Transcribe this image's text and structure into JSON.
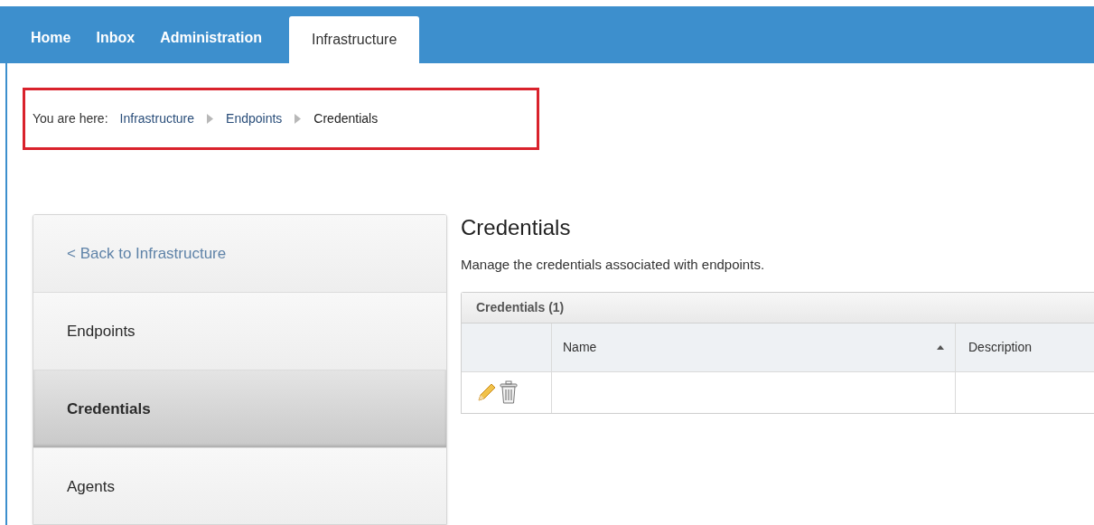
{
  "tabs": [
    {
      "label": "Home",
      "selected": false
    },
    {
      "label": "Inbox",
      "selected": false
    },
    {
      "label": "Administration",
      "selected": false
    },
    {
      "label": "Infrastructure",
      "selected": true
    }
  ],
  "breadcrumb": {
    "label": "You are here:",
    "items": [
      {
        "label": "Infrastructure",
        "kind": "link"
      },
      {
        "label": "Endpoints",
        "kind": "link"
      },
      {
        "label": "Credentials",
        "kind": "current"
      }
    ]
  },
  "sidebar": {
    "items": [
      {
        "label": "< Back to Infrastructure",
        "kind": "link",
        "selected": false
      },
      {
        "label": "Endpoints",
        "kind": "item",
        "selected": false
      },
      {
        "label": "Credentials",
        "kind": "item",
        "selected": true
      },
      {
        "label": "Agents",
        "kind": "item",
        "selected": false
      }
    ]
  },
  "page": {
    "title": "Credentials",
    "description": "Manage the credentials associated with endpoints."
  },
  "table": {
    "title": "Credentials (1)",
    "columns": [
      {
        "label": "Name",
        "sorted": true
      },
      {
        "label": "Description",
        "sorted": false
      }
    ],
    "rows": [
      {
        "editable": true,
        "deletable": true
      }
    ]
  }
}
